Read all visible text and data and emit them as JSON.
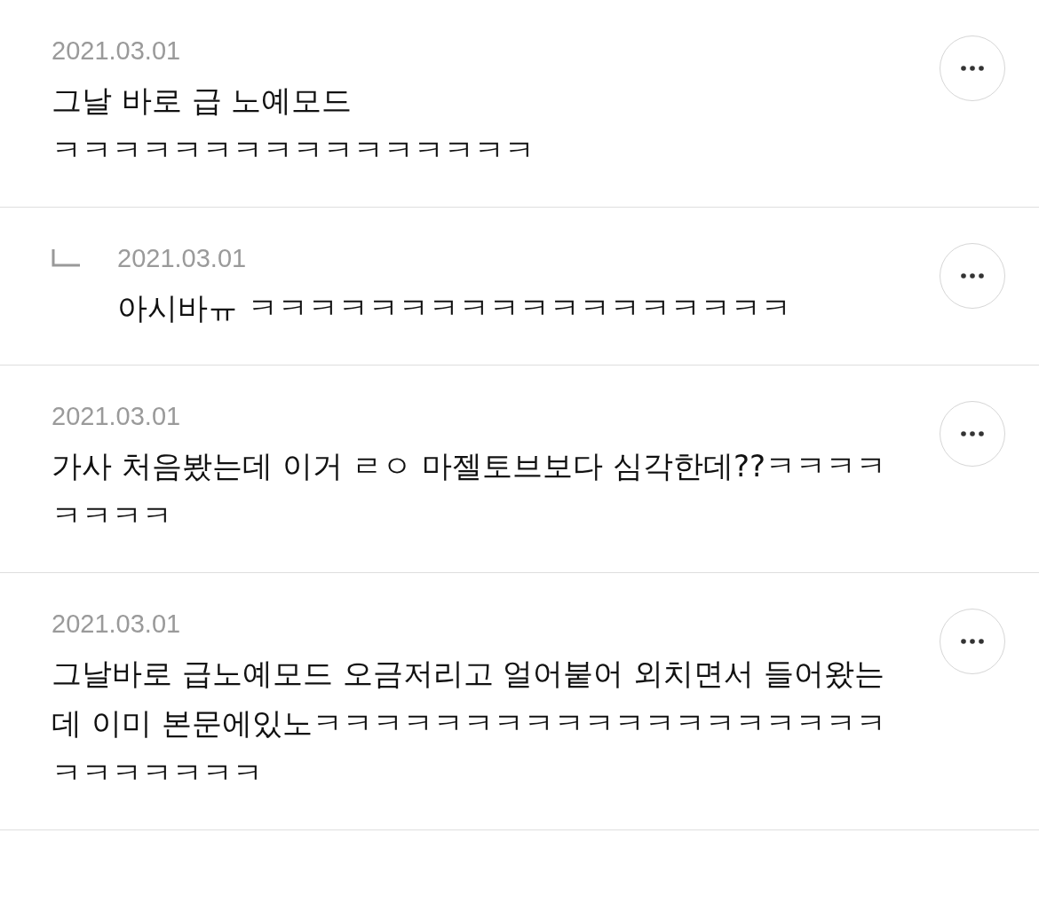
{
  "comments": [
    {
      "kind": "comment",
      "date": "2021.03.01",
      "text": "그날 바로 급 노예모드\nㅋㅋㅋㅋㅋㅋㅋㅋㅋㅋㅋㅋㅋㅋㅋㅋ"
    },
    {
      "kind": "reply",
      "date": "2021.03.01",
      "text": "아시바ㅠ ㅋㅋㅋㅋㅋㅋㅋㅋㅋㅋㅋㅋㅋㅋㅋㅋㅋㅋ"
    },
    {
      "kind": "comment",
      "date": "2021.03.01",
      "text": "가사 처음봤는데 이거 ㄹㅇ 마젤토브보다 심각한데??ㅋㅋㅋㅋㅋㅋㅋㅋ"
    },
    {
      "kind": "comment",
      "date": "2021.03.01",
      "text": "그날바로 급노예모드 오금저리고 얼어붙어 외치면서 들어왔는데 이미 본문에있노ㅋㅋㅋㅋㅋㅋㅋㅋㅋㅋㅋㅋㅋㅋㅋㅋㅋㅋㅋㅋㅋㅋㅋㅋㅋㅋ"
    }
  ]
}
